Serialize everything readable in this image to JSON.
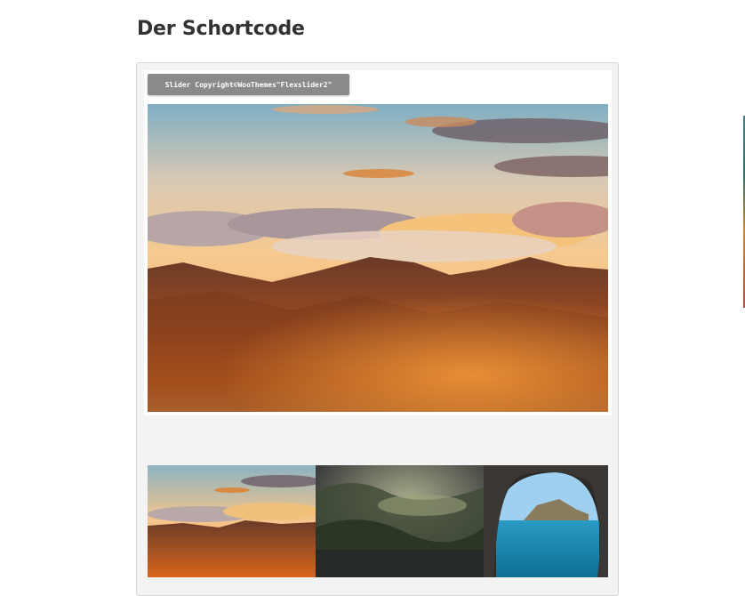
{
  "page": {
    "title": "Der Schortcode"
  },
  "shortcode_box": {
    "code_label": "Slider Copyright©WooThemes\"Flexslider2\""
  },
  "slider": {
    "main_image": "mountain-sunset-clouds",
    "thumbnails": [
      {
        "image": "mountain-sunset-clouds"
      },
      {
        "image": "misty-forest"
      },
      {
        "image": "sea-cave-coast"
      }
    ]
  },
  "colors": {
    "box_background": "#f3f3f3",
    "badge_background": "#8a8a8a",
    "title_color": "#333333"
  }
}
